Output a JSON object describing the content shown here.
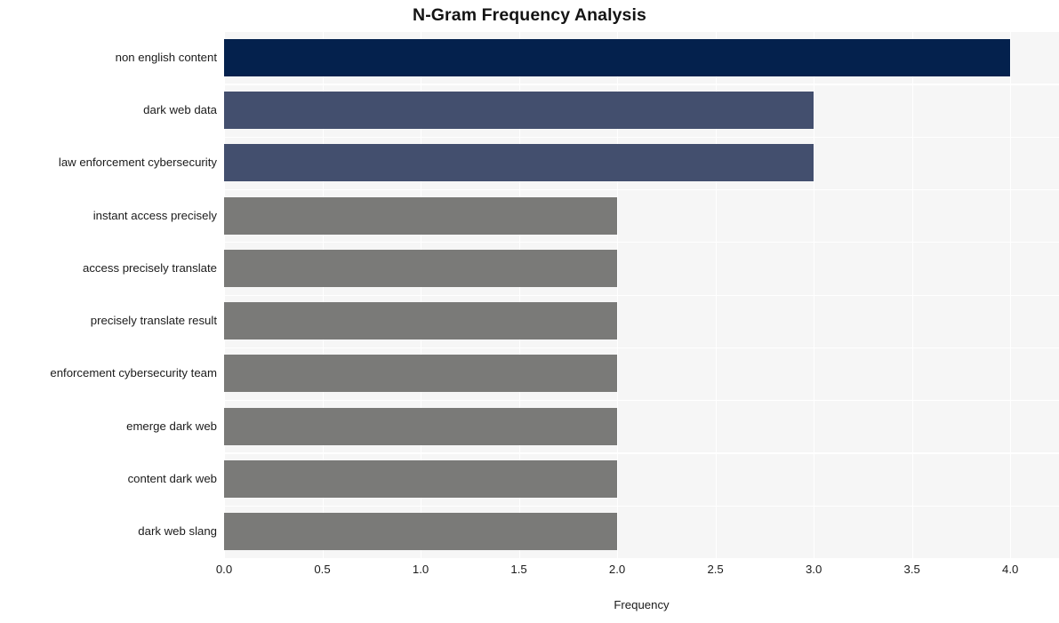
{
  "chart_data": {
    "type": "bar",
    "orientation": "horizontal",
    "title": "N-Gram Frequency Analysis",
    "xlabel": "Frequency",
    "ylabel": "",
    "xlim": [
      0.0,
      4.248
    ],
    "xticks": [
      "0.0",
      "0.5",
      "1.0",
      "1.5",
      "2.0",
      "2.5",
      "3.0",
      "3.5",
      "4.0"
    ],
    "xtick_values": [
      0.0,
      0.5,
      1.0,
      1.5,
      2.0,
      2.5,
      3.0,
      3.5,
      4.0
    ],
    "grid": true,
    "legend": null,
    "categories": [
      "non english content",
      "dark web data",
      "law enforcement cybersecurity",
      "instant access precisely",
      "access precisely translate",
      "precisely translate result",
      "enforcement cybersecurity team",
      "emerge dark web",
      "content dark web",
      "dark web slang"
    ],
    "values": [
      4,
      3,
      3,
      2,
      2,
      2,
      2,
      2,
      2,
      2
    ],
    "bar_colors": [
      "#04214d",
      "#434f6e",
      "#434f6e",
      "#7a7a78",
      "#7a7a78",
      "#7a7a78",
      "#7a7a78",
      "#7a7a78",
      "#7a7a78",
      "#7a7a78"
    ]
  },
  "style": {
    "figure_background": "#ffffff",
    "plot_background": "#f6f6f6",
    "gridline_color": "#ffffff",
    "text_color": "#1b1b1b",
    "title_color": "#141414"
  }
}
